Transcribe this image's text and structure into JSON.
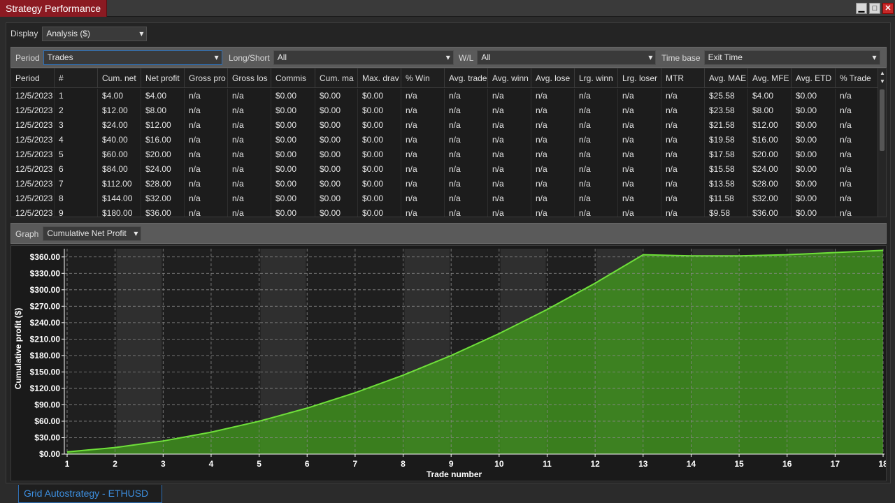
{
  "window": {
    "title": "Strategy Performance",
    "minimize": "▁",
    "maximize": "□",
    "close": "✕"
  },
  "display": {
    "label": "Display",
    "value": "Analysis ($)"
  },
  "filters": {
    "period": {
      "label": "Period",
      "value": "Trades"
    },
    "long_short": {
      "label": "Long/Short",
      "value": "All"
    },
    "wl": {
      "label": "W/L",
      "value": "All"
    },
    "time_base": {
      "label": "Time base",
      "value": "Exit Time"
    }
  },
  "grid": {
    "columns": [
      "Period",
      "#",
      "Cum. net",
      "Net profit",
      "Gross pro",
      "Gross los",
      "Commis",
      "Cum. ma",
      "Max. drav",
      "% Win",
      "Avg. trade",
      "Avg. winn",
      "Avg. lose",
      "Lrg. winn",
      "Lrg. loser",
      "MTR",
      "Avg. MAE",
      "Avg. MFE",
      "Avg. ETD",
      "% Trade"
    ],
    "rows": [
      [
        "12/5/2023",
        "1",
        "$4.00",
        "$4.00",
        "n/a",
        "n/a",
        "$0.00",
        "$0.00",
        "$0.00",
        "n/a",
        "n/a",
        "n/a",
        "n/a",
        "n/a",
        "n/a",
        "n/a",
        "$25.58",
        "$4.00",
        "$0.00",
        "n/a"
      ],
      [
        "12/5/2023",
        "2",
        "$12.00",
        "$8.00",
        "n/a",
        "n/a",
        "$0.00",
        "$0.00",
        "$0.00",
        "n/a",
        "n/a",
        "n/a",
        "n/a",
        "n/a",
        "n/a",
        "n/a",
        "$23.58",
        "$8.00",
        "$0.00",
        "n/a"
      ],
      [
        "12/5/2023",
        "3",
        "$24.00",
        "$12.00",
        "n/a",
        "n/a",
        "$0.00",
        "$0.00",
        "$0.00",
        "n/a",
        "n/a",
        "n/a",
        "n/a",
        "n/a",
        "n/a",
        "n/a",
        "$21.58",
        "$12.00",
        "$0.00",
        "n/a"
      ],
      [
        "12/5/2023",
        "4",
        "$40.00",
        "$16.00",
        "n/a",
        "n/a",
        "$0.00",
        "$0.00",
        "$0.00",
        "n/a",
        "n/a",
        "n/a",
        "n/a",
        "n/a",
        "n/a",
        "n/a",
        "$19.58",
        "$16.00",
        "$0.00",
        "n/a"
      ],
      [
        "12/5/2023",
        "5",
        "$60.00",
        "$20.00",
        "n/a",
        "n/a",
        "$0.00",
        "$0.00",
        "$0.00",
        "n/a",
        "n/a",
        "n/a",
        "n/a",
        "n/a",
        "n/a",
        "n/a",
        "$17.58",
        "$20.00",
        "$0.00",
        "n/a"
      ],
      [
        "12/5/2023",
        "6",
        "$84.00",
        "$24.00",
        "n/a",
        "n/a",
        "$0.00",
        "$0.00",
        "$0.00",
        "n/a",
        "n/a",
        "n/a",
        "n/a",
        "n/a",
        "n/a",
        "n/a",
        "$15.58",
        "$24.00",
        "$0.00",
        "n/a"
      ],
      [
        "12/5/2023",
        "7",
        "$112.00",
        "$28.00",
        "n/a",
        "n/a",
        "$0.00",
        "$0.00",
        "$0.00",
        "n/a",
        "n/a",
        "n/a",
        "n/a",
        "n/a",
        "n/a",
        "n/a",
        "$13.58",
        "$28.00",
        "$0.00",
        "n/a"
      ],
      [
        "12/5/2023",
        "8",
        "$144.00",
        "$32.00",
        "n/a",
        "n/a",
        "$0.00",
        "$0.00",
        "$0.00",
        "n/a",
        "n/a",
        "n/a",
        "n/a",
        "n/a",
        "n/a",
        "n/a",
        "$11.58",
        "$32.00",
        "$0.00",
        "n/a"
      ],
      [
        "12/5/2023",
        "9",
        "$180.00",
        "$36.00",
        "n/a",
        "n/a",
        "$0.00",
        "$0.00",
        "$0.00",
        "n/a",
        "n/a",
        "n/a",
        "n/a",
        "n/a",
        "n/a",
        "n/a",
        "$9.58",
        "$36.00",
        "$0.00",
        "n/a"
      ]
    ]
  },
  "graph": {
    "label": "Graph",
    "value": "Cumulative Net Profit"
  },
  "chart_data": {
    "type": "area",
    "xlabel": "Trade number",
    "ylabel": "Cumulative profit ($)",
    "x": [
      1,
      2,
      3,
      4,
      5,
      6,
      7,
      8,
      9,
      10,
      11,
      12,
      13,
      14,
      15,
      16,
      17,
      18
    ],
    "values": [
      4,
      12,
      24,
      40,
      60,
      84,
      112,
      144,
      180,
      220,
      264,
      312,
      364,
      362,
      362,
      364,
      368,
      372
    ],
    "yticks": [
      "$0.00",
      "$30.00",
      "$60.00",
      "$90.00",
      "$120.00",
      "$150.00",
      "$180.00",
      "$210.00",
      "$240.00",
      "$270.00",
      "$300.00",
      "$330.00",
      "$360.00"
    ],
    "ylim": [
      0,
      375
    ],
    "grid": true,
    "fill_color": "#3f8f1e",
    "line_color": "#6fe03a"
  },
  "bottom_tab": {
    "label": "Grid Autostrategy - ETHUSD"
  }
}
